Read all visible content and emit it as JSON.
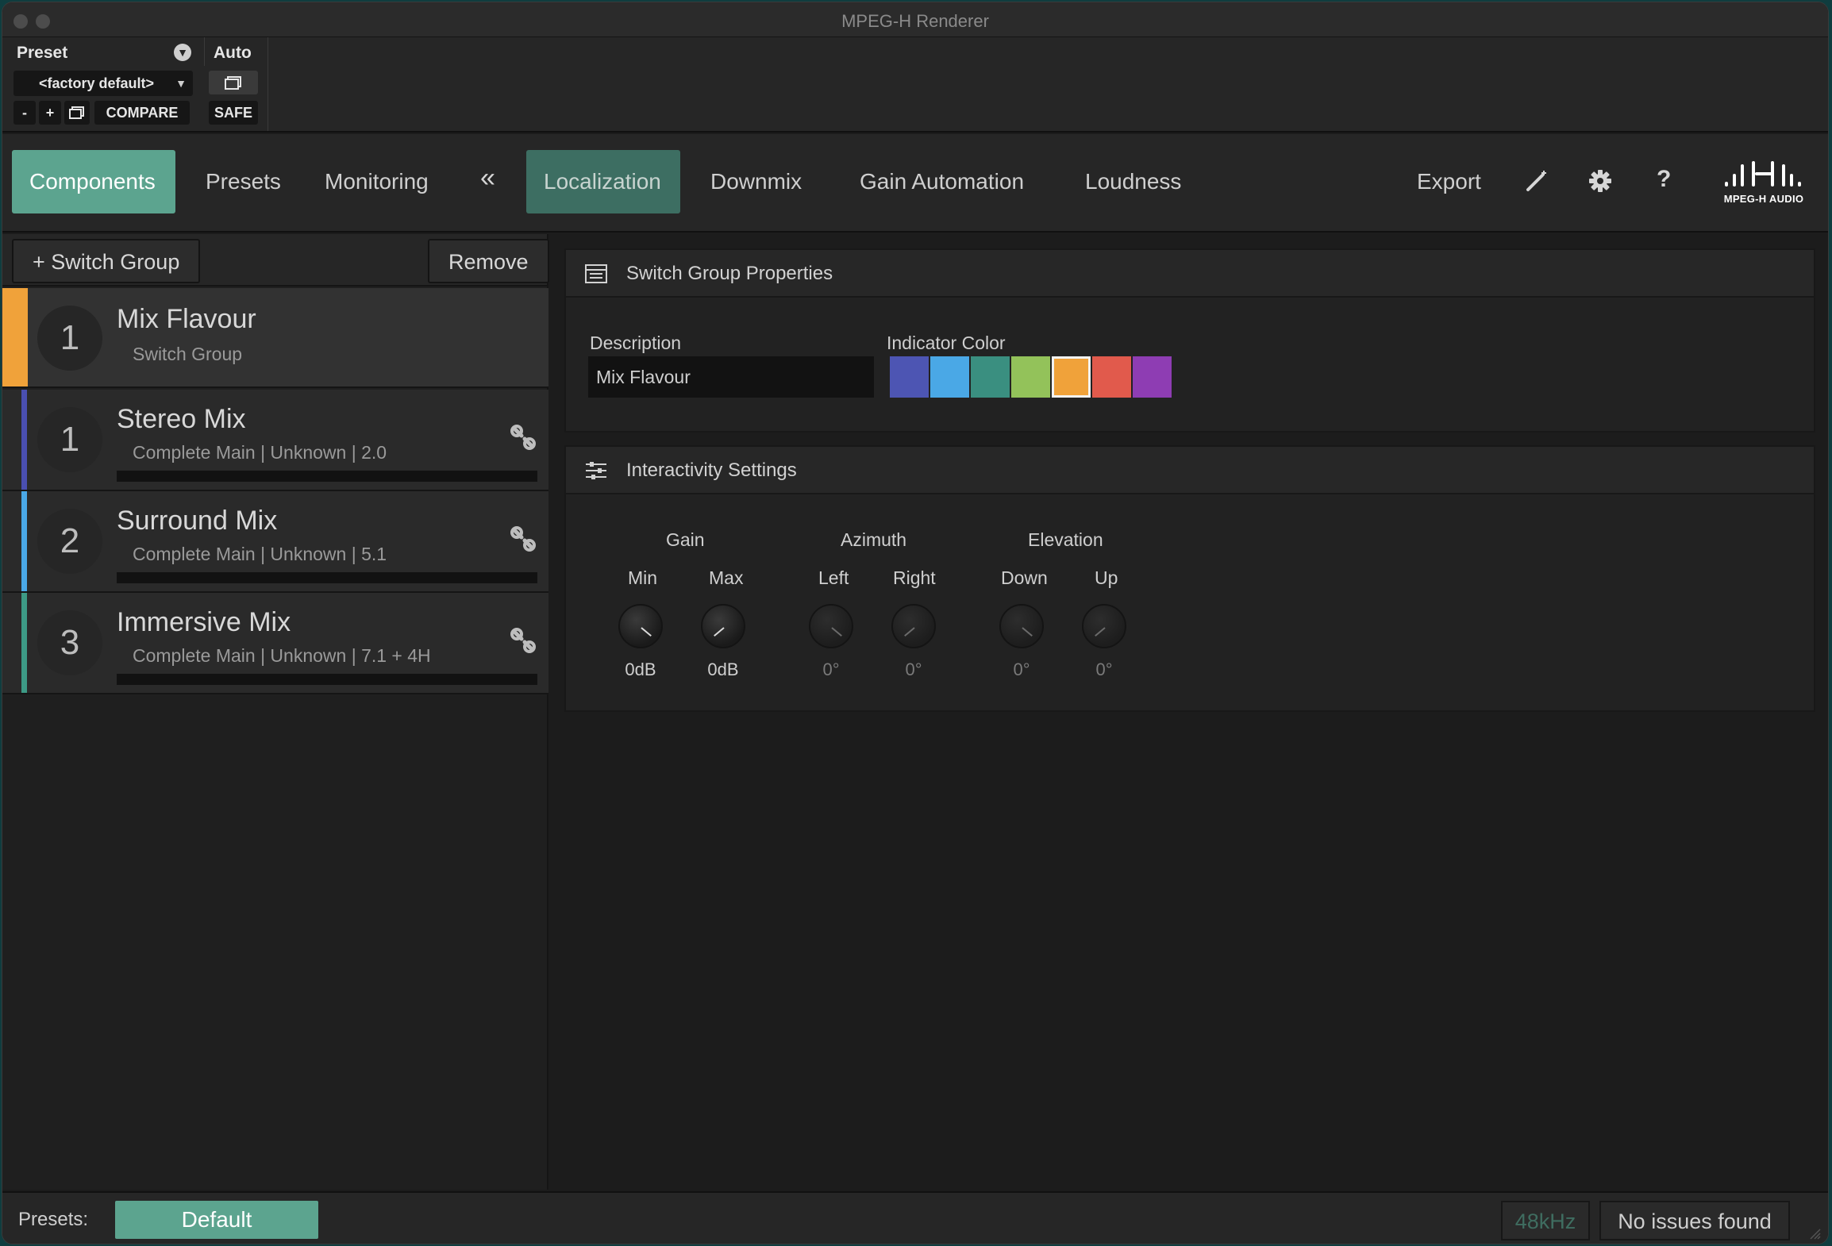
{
  "window": {
    "title": "MPEG-H Renderer"
  },
  "host": {
    "preset_label": "Preset",
    "auto_label": "Auto",
    "preset_value": "<factory default>",
    "minus": "-",
    "plus": "+",
    "compare": "COMPARE",
    "safe": "SAFE"
  },
  "nav": {
    "tabs": [
      {
        "label": "Components",
        "state": "active"
      },
      {
        "label": "Presets",
        "state": "normal"
      },
      {
        "label": "Monitoring",
        "state": "normal"
      },
      {
        "label": "Localization",
        "state": "highlighted"
      },
      {
        "label": "Downmix",
        "state": "normal"
      },
      {
        "label": "Gain Automation",
        "state": "normal"
      },
      {
        "label": "Loudness",
        "state": "normal"
      }
    ],
    "collapse_glyph": "«",
    "export_label": "Export",
    "help_glyph": "?",
    "logo_text": "MPEG-H AUDIO"
  },
  "left": {
    "add_switch_group": "+ Switch Group",
    "remove": "Remove",
    "switch_group": {
      "number": "1",
      "title": "Mix Flavour",
      "subtitle": "Switch Group",
      "color": "#f0a23a"
    },
    "components": [
      {
        "number": "1",
        "title": "Stereo Mix",
        "subtitle": "Complete Main | Unknown | 2.0",
        "color": "#4a4fb0"
      },
      {
        "number": "2",
        "title": "Surround Mix",
        "subtitle": "Complete Main | Unknown | 5.1",
        "color": "#4aa8e6"
      },
      {
        "number": "3",
        "title": "Immersive Mix",
        "subtitle": "Complete Main | Unknown | 7.1 + 4H",
        "color": "#3d9a86"
      }
    ]
  },
  "properties": {
    "header": "Switch Group Properties",
    "description_label": "Description",
    "description_value": "Mix Flavour",
    "indicator_label": "Indicator Color",
    "colors": [
      "#4d55b3",
      "#4aa8e6",
      "#3a8f80",
      "#93c25a",
      "#f0a23a",
      "#e15a4c",
      "#8e3db3"
    ],
    "selected_color": "#f0a23a"
  },
  "interactivity": {
    "header": "Interactivity Settings",
    "groups": [
      {
        "label": "Gain",
        "knobs": [
          {
            "label": "Min",
            "value": "0dB"
          },
          {
            "label": "Max",
            "value": "0dB"
          }
        ]
      },
      {
        "label": "Azimuth",
        "knobs": [
          {
            "label": "Left",
            "value": "0°"
          },
          {
            "label": "Right",
            "value": "0°"
          }
        ]
      },
      {
        "label": "Elevation",
        "knobs": [
          {
            "label": "Down",
            "value": "0°"
          },
          {
            "label": "Up",
            "value": "0°"
          }
        ]
      }
    ]
  },
  "status": {
    "presets_label": "Presets:",
    "default_button": "Default",
    "sample_rate": "48kHz",
    "issues": "No issues found"
  }
}
